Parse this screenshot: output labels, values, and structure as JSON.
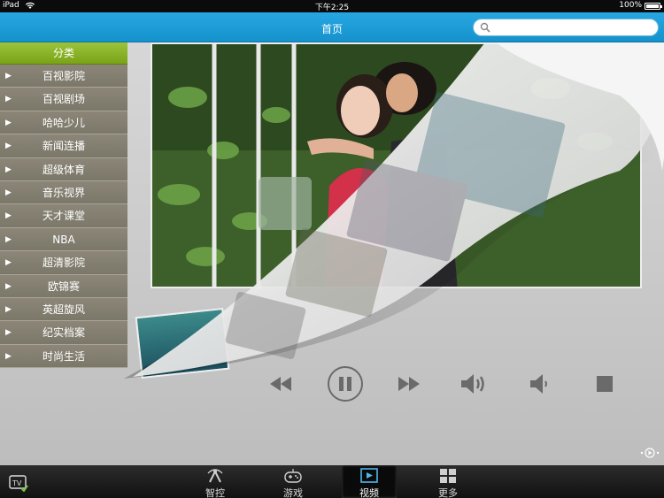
{
  "status": {
    "carrier": "iPad",
    "time": "下午2:25",
    "battery": "100%"
  },
  "nav": {
    "title": "首页",
    "search_placeholder": ""
  },
  "sidebar": {
    "header": "分类",
    "items": [
      {
        "label": "百视影院"
      },
      {
        "label": "百视剧场"
      },
      {
        "label": "哈哈少儿"
      },
      {
        "label": "新闻连播"
      },
      {
        "label": "超级体育"
      },
      {
        "label": "音乐视界"
      },
      {
        "label": "天才课堂"
      },
      {
        "label": "NBA"
      },
      {
        "label": "超清影院"
      },
      {
        "label": "欧锦赛"
      },
      {
        "label": "英超旋风"
      },
      {
        "label": "纪实档案"
      },
      {
        "label": "时尚生活"
      }
    ]
  },
  "player": {
    "controls": [
      "rewind-icon",
      "pause-icon",
      "fast-forward-icon",
      "volume-up-icon",
      "volume-down-icon",
      "stop-icon"
    ]
  },
  "tabbar": {
    "tabs": [
      {
        "label": "智控",
        "icon": "remote-control-icon"
      },
      {
        "label": "游戏",
        "icon": "gamepad-icon"
      },
      {
        "label": "视频",
        "icon": "video-icon",
        "active": true
      },
      {
        "label": "更多",
        "icon": "more-grid-icon"
      }
    ]
  }
}
